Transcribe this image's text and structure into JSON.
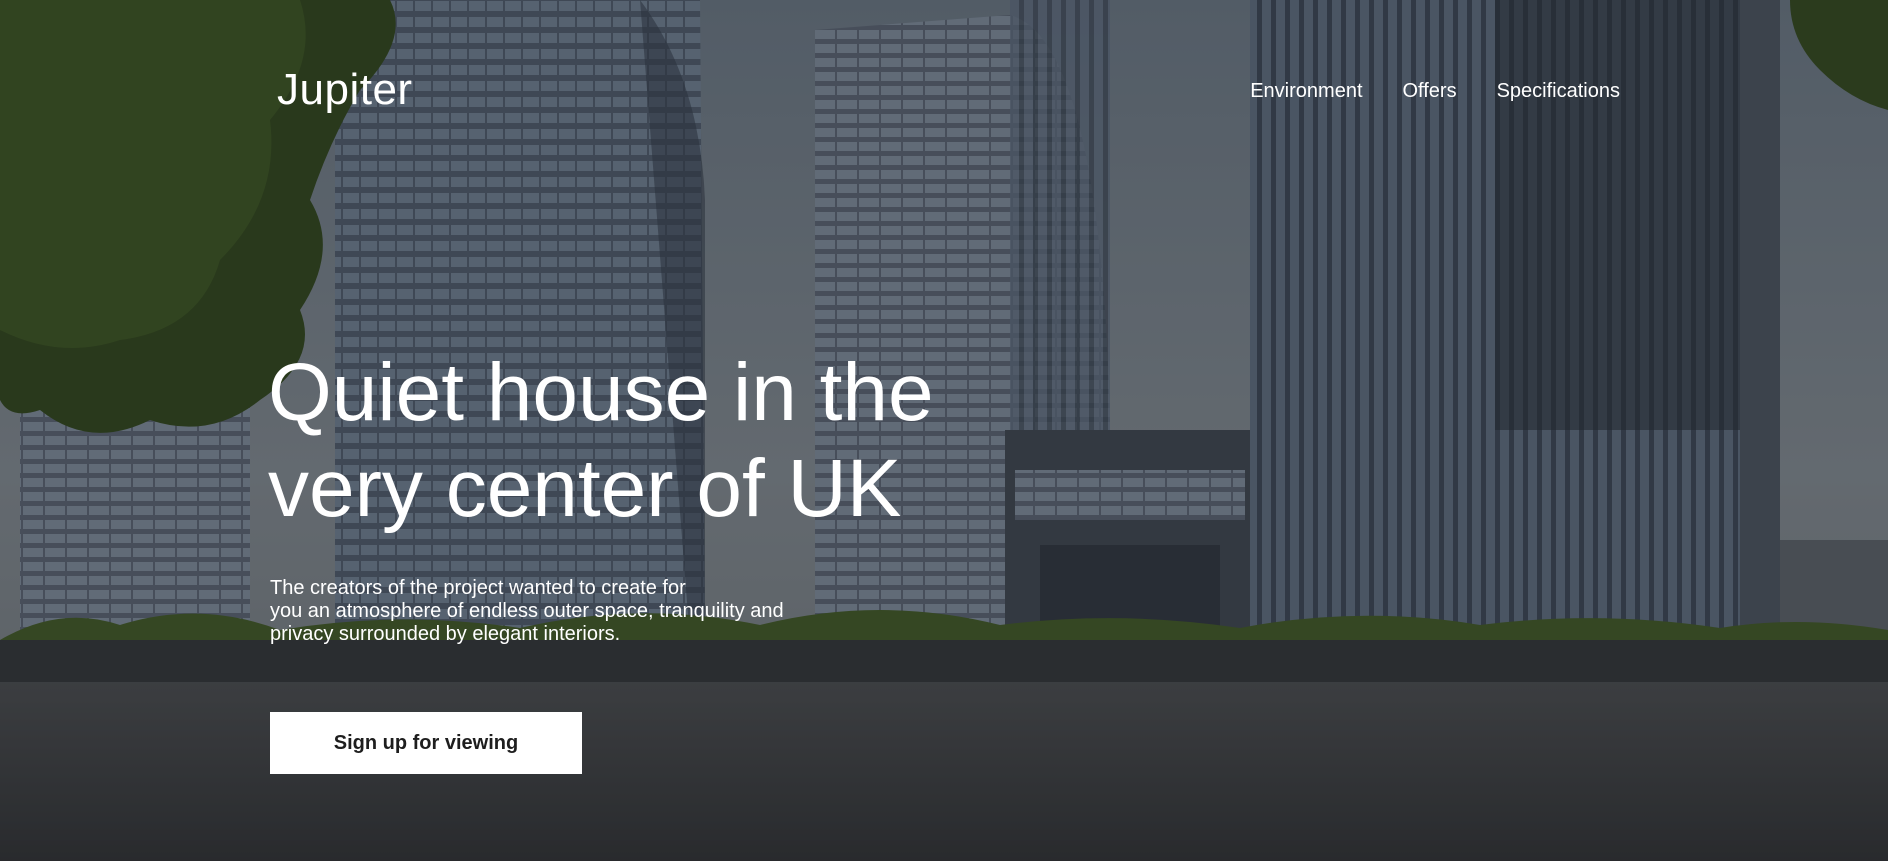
{
  "brand": {
    "logo_text": "Jupiter"
  },
  "nav": {
    "items": [
      {
        "label": "Environment"
      },
      {
        "label": "Offers"
      },
      {
        "label": "Specifications"
      }
    ]
  },
  "hero": {
    "headline_lines": [
      "Quiet house in the",
      "very center of UK"
    ],
    "description_lines": [
      "The creators of the project wanted to create for",
      "you an atmosphere of endless outer space, tranquility and",
      "privacy surrounded by elegant interiors."
    ],
    "cta_label": "Sign up for viewing"
  },
  "colors": {
    "text": "#ffffff",
    "button_bg": "#ffffff",
    "button_text": "#1e1e1e"
  }
}
